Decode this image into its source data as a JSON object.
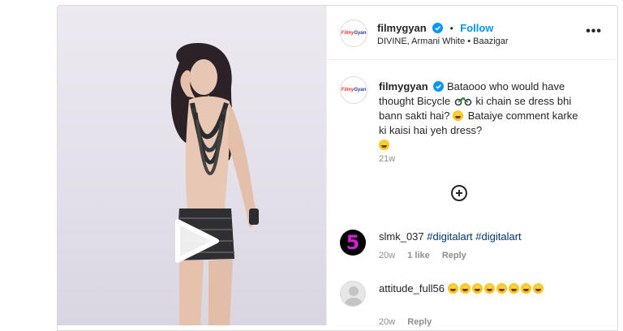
{
  "header": {
    "username": "filmygyan",
    "follow_label": "Follow",
    "separator": "•",
    "audio": "DIVINE, Armani White • Baazigar",
    "more": "•••"
  },
  "caption": {
    "username": "filmygyan",
    "text_part1": "Bataooo who would have thought Bicycle",
    "text_part2": "ki chain se dress bhi bann sakti hai?",
    "text_part3": "Bataiye comment karke ki kaisi hai yeh dress?",
    "time": "21w"
  },
  "comments": [
    {
      "username": "slmk_037",
      "avatar_char": "5",
      "tags": [
        "#digitalart",
        "#digitalart"
      ],
      "time": "20w",
      "likes": "1 like",
      "reply": "Reply"
    },
    {
      "username": "attitude_full56",
      "emoji_count": 8,
      "time": "20w",
      "reply": "Reply"
    }
  ],
  "logo_text": {
    "a": "Filmy",
    "b": "Gyan"
  },
  "colors": {
    "accent": "#0095f6",
    "verified": "#0095f6",
    "avatar_five": "#d11fd8"
  }
}
